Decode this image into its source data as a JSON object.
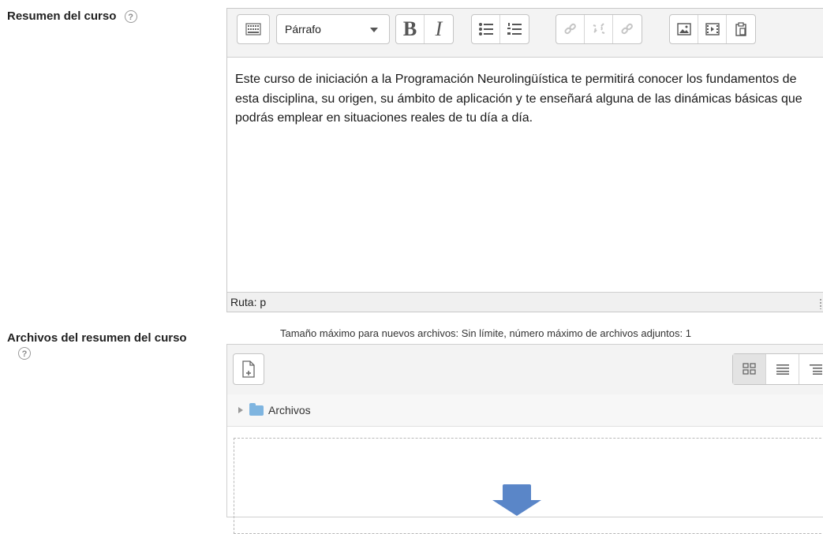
{
  "summary": {
    "label": "Resumen del curso",
    "help_glyph": "?",
    "editor": {
      "format_value": "Párrafo",
      "bold_label": "B",
      "italic_label": "I",
      "content": "Este curso de iniciación a la Programación Neurolingüística te permitirá conocer los fundamentos de esta disciplina, su origen, su ámbito de aplicación y te enseñará alguna de las dinámicas básicas que podrás emplear en situaciones reales de tu día a día.",
      "status_path": "Ruta: p"
    }
  },
  "files": {
    "label": "Archivos del resumen del curso",
    "help_glyph": "?",
    "max_info": "Tamaño máximo para nuevos archivos: Sin límite, número máximo de archivos adjuntos: 1",
    "folder_label": "Archivos"
  },
  "colors": {
    "accent_arrow": "#5a86c8",
    "folder": "#7fb5e0"
  }
}
